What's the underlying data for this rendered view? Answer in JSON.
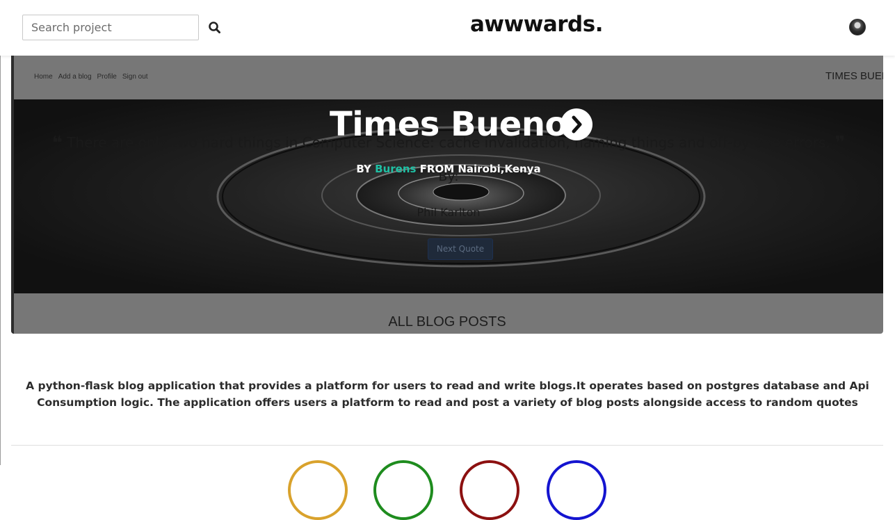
{
  "header": {
    "search": {
      "placeholder": "Search project",
      "value": ""
    },
    "logo": "awwwards."
  },
  "embedded_site": {
    "nav": [
      "Home",
      "Add a blog",
      "Profile",
      "Sign out"
    ],
    "brand": "TIMES BUENO",
    "hero": {
      "title": "Times Bueno",
      "byline": {
        "prefix": "BY",
        "user": "Burens",
        "location": "FROM Nairobi,Kenya"
      }
    },
    "quote": {
      "open_mark": "❝",
      "text": "There are only two hard things in Computer Science: cache invalidation, naming things and off-by-one errors.",
      "close_mark": "❞",
      "by_label": "By:",
      "author": "Phil Karlton",
      "button": "Next Quote"
    },
    "section_heading": "ALL BLOG POSTS"
  },
  "description": "A python-flask blog application that provides a platform for users to read and write blogs.It operates based on postgres database and Api Consumption logic. The application offers users a platform to read and post a variety of blog posts alongside access to random quotes",
  "colors": {
    "accent_user": "#1fc0a4",
    "rating_circles": [
      "#d9a22c",
      "#1e8c1e",
      "#8c1010",
      "#1414d0"
    ]
  },
  "icons": {
    "search": "magnifier-icon",
    "next": "chevron-right-icon",
    "avatar": "user-avatar"
  }
}
